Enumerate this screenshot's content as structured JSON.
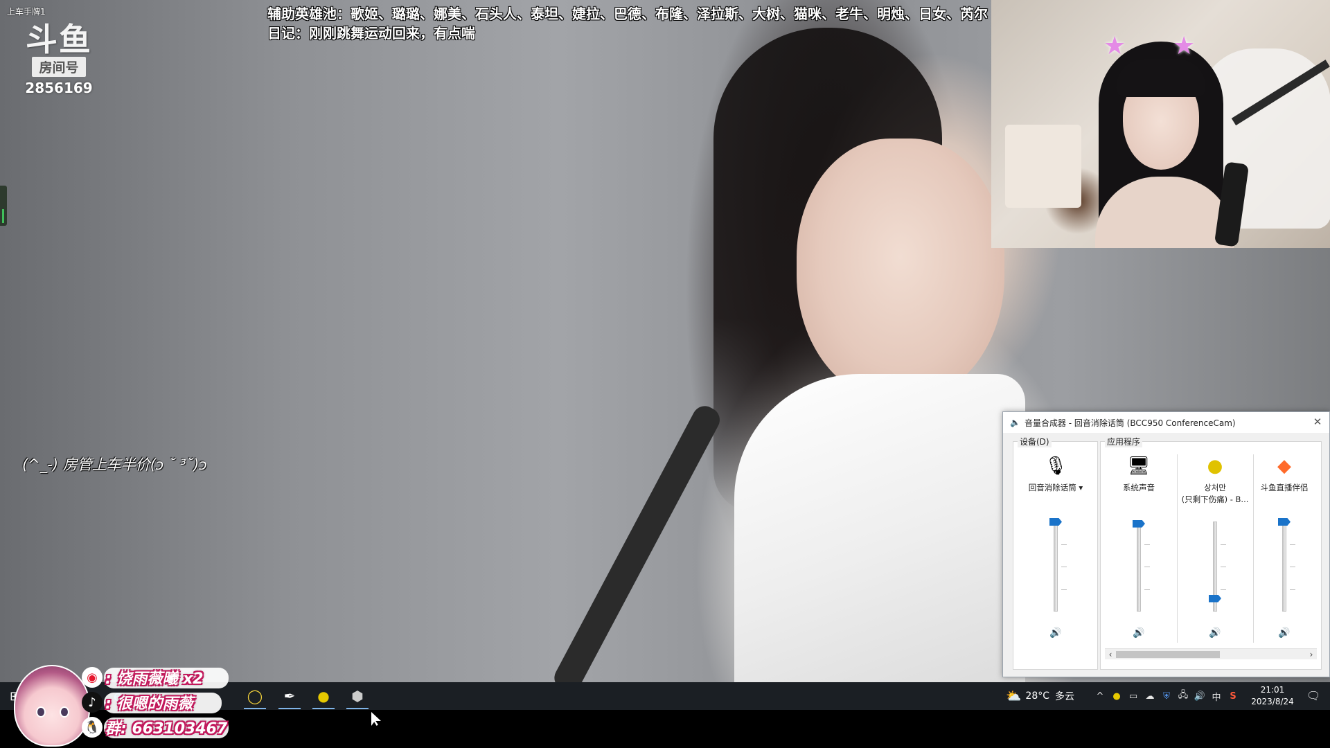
{
  "overlay": {
    "corner_tag": "上车手牌1",
    "logo": {
      "mark": "斗鱼",
      "room_label": "房间号",
      "room_id": "2856169"
    },
    "headline_line1": "辅助英雄池：歌姬、璐璐、娜美、石头人、泰坦、婕拉、巴德、布隆、泽拉斯、大树、猫咪、老牛、明烛、日女、芮尔",
    "headline_line2": "日记：刚刚跳舞运动回来，有点喘",
    "promo": "(^_-) 房管上车半价(ɔ ˘ ³˘)ɔ"
  },
  "social": {
    "weibo": ": 饶雨薇曦 x2",
    "douyin": ": 很嗯的雨薇",
    "qq_group": "群: 663103467",
    "weibo_icon": "weibo-icon",
    "douyin_icon": "douyin-icon",
    "qq_icon": "qq-penguin-icon"
  },
  "mixer": {
    "title": "音量合成器 - 回音消除话筒 (BCC950 ConferenceCam)",
    "device_group_label": "设备(D)",
    "apps_group_label": "应用程序",
    "channels": [
      {
        "id": "device",
        "name": "回音消除话筒 ▾",
        "icon": "microphone-icon",
        "level": 1.0,
        "muted": false
      },
      {
        "id": "system",
        "name": "系统声音",
        "icon": "system-sounds-icon",
        "level": 0.98,
        "muted": false
      },
      {
        "id": "music",
        "name": "상처만\n(只剩下伤痛) - B...",
        "icon": "music-app-icon",
        "level": 0.15,
        "muted": false
      },
      {
        "id": "douyu",
        "name": "斗鱼直播伴侣",
        "icon": "douyu-companion-icon",
        "level": 1.0,
        "muted": false
      }
    ],
    "colors": {
      "slider_thumb": "#1a73c9",
      "window_bg": "#f0f0f0"
    }
  },
  "taskbar": {
    "apps": [
      "start-icon",
      "edge-icon",
      "cortana-icon",
      "pen-app-icon",
      "music-icon",
      "shield-icon"
    ],
    "weather_temp": "28°C",
    "weather_desc": "多云",
    "ime": "中",
    "time": "21:01",
    "date": "2023/8/24",
    "notification_count": "1",
    "colors": {
      "background": "#1b1f24"
    }
  }
}
